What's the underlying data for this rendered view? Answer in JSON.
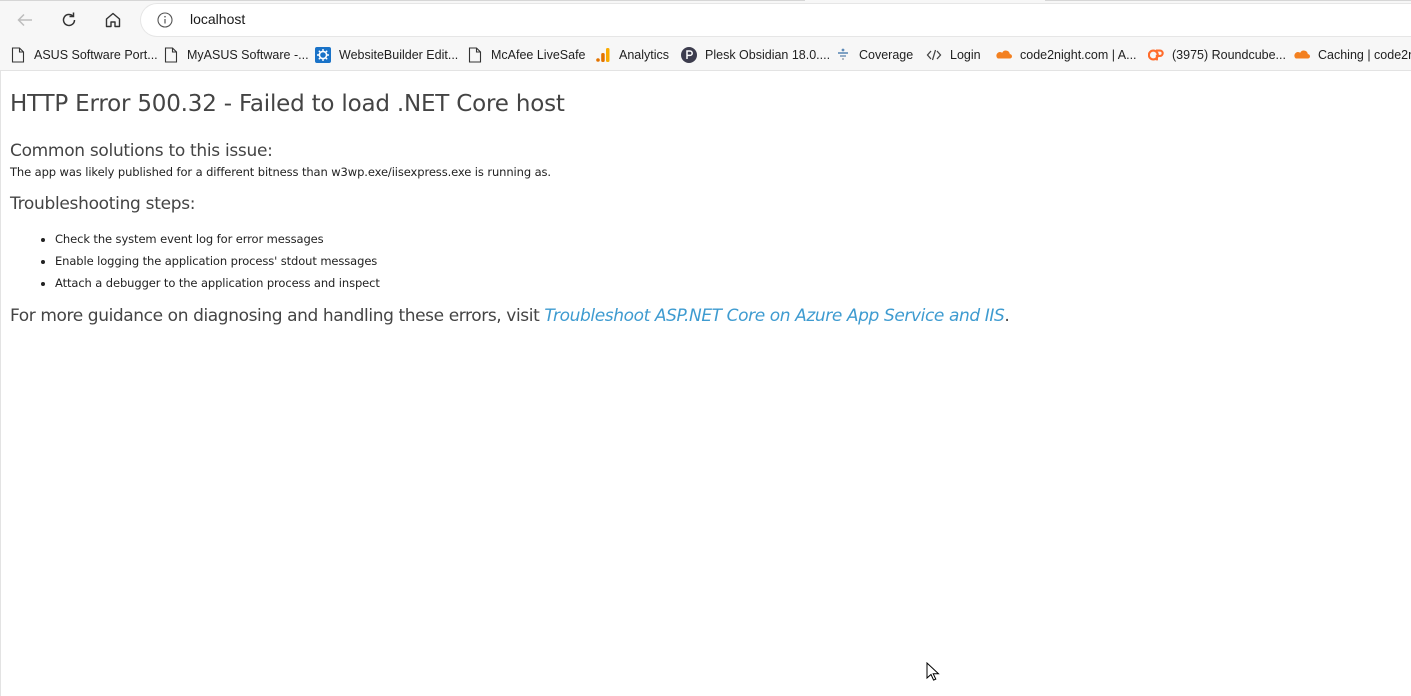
{
  "browser": {
    "url": "localhost",
    "bookmarks": [
      {
        "label": "ASUS Software Port...",
        "icon": "page-icon"
      },
      {
        "label": "MyASUS Software -...",
        "icon": "page-icon"
      },
      {
        "label": "WebsiteBuilder Edit...",
        "icon": "gear-icon"
      },
      {
        "label": "McAfee LiveSafe",
        "icon": "page-icon"
      },
      {
        "label": "Analytics",
        "icon": "analytics-icon"
      },
      {
        "label": "Plesk Obsidian 18.0....",
        "icon": "plesk-icon"
      },
      {
        "label": "Coverage",
        "icon": "coverage-icon"
      },
      {
        "label": "Login",
        "icon": "code-icon"
      },
      {
        "label": "code2night.com | A...",
        "icon": "cloudflare-icon"
      },
      {
        "label": "(3975) Roundcube...",
        "icon": "cpanel-icon"
      },
      {
        "label": "Caching | code2n",
        "icon": "cloudflare-icon"
      }
    ]
  },
  "page": {
    "title": "HTTP Error 500.32 - Failed to load .NET Core host",
    "common_heading": "Common solutions to this issue:",
    "common_text": "The app was likely published for a different bitness than w3wp.exe/iisexpress.exe is running as.",
    "troubleshooting_heading": "Troubleshooting steps:",
    "steps": [
      "Check the system event log for error messages",
      "Enable logging the application process' stdout messages",
      "Attach a debugger to the application process and inspect"
    ],
    "guidance_prefix": "For more guidance on diagnosing and handling these errors, visit ",
    "guidance_link": "Troubleshoot ASP.NET Core on Azure App Service and IIS",
    "guidance_suffix": "."
  }
}
